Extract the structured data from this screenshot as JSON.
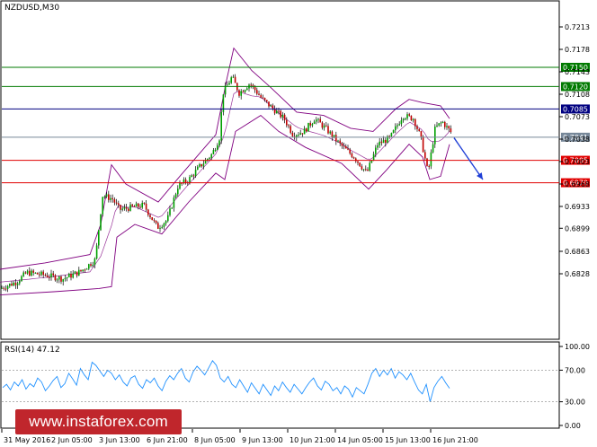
{
  "chart_data": [
    {
      "type": "candlestick",
      "title": "NZDUSD,M30",
      "ylim": [
        0.68,
        0.725
      ],
      "y_ticks": [
        "0.7213",
        "0.7178",
        "0.7143",
        "0.7108",
        "0.7073",
        "0.7038",
        "0.7003",
        "0.6968",
        "0.6933",
        "0.6899",
        "0.6863",
        "0.6828"
      ],
      "x_ticks": [
        "31 May 2016",
        "2 Jun 05:00",
        "3 Jun 13:00",
        "6 Jun 21:00",
        "8 Jun 05:00",
        "9 Jun 13:00",
        "10 Jun 21:00",
        "14 Jun 05:00",
        "15 Jun 13:00",
        "16 Jun 21:00"
      ],
      "levels": [
        {
          "label": "0.7150",
          "value": 0.715,
          "color": "#007a00"
        },
        {
          "label": "0.7120",
          "value": 0.712,
          "color": "#007a00"
        },
        {
          "label": "0.7085",
          "value": 0.7085,
          "color": "#000080"
        },
        {
          "label": "0.7041",
          "value": 0.7041,
          "color": "#778899"
        },
        {
          "label": "0.7005",
          "value": 0.7005,
          "color": "#e00000"
        },
        {
          "label": "0.6970",
          "value": 0.697,
          "color": "#e00000"
        }
      ],
      "close_path": [
        [
          0,
          0.6805
        ],
        [
          18,
          0.6815
        ],
        [
          30,
          0.683
        ],
        [
          50,
          0.6826
        ],
        [
          70,
          0.682
        ],
        [
          90,
          0.6832
        ],
        [
          106,
          0.685
        ],
        [
          114,
          0.695
        ],
        [
          125,
          0.6945
        ],
        [
          133,
          0.6928
        ],
        [
          148,
          0.6932
        ],
        [
          160,
          0.6935
        ],
        [
          175,
          0.69
        ],
        [
          186,
          0.6912
        ],
        [
          198,
          0.6965
        ],
        [
          210,
          0.6975
        ],
        [
          222,
          0.6995
        ],
        [
          236,
          0.7015
        ],
        [
          244,
          0.704
        ],
        [
          248,
          0.711
        ],
        [
          258,
          0.7135
        ],
        [
          266,
          0.711
        ],
        [
          278,
          0.7125
        ],
        [
          292,
          0.71
        ],
        [
          304,
          0.7085
        ],
        [
          316,
          0.707
        ],
        [
          326,
          0.7045
        ],
        [
          338,
          0.705
        ],
        [
          350,
          0.707
        ],
        [
          362,
          0.7055
        ],
        [
          378,
          0.703
        ],
        [
          394,
          0.701
        ],
        [
          408,
          0.6985
        ],
        [
          420,
          0.703
        ],
        [
          434,
          0.704
        ],
        [
          448,
          0.7075
        ],
        [
          460,
          0.707
        ],
        [
          468,
          0.704
        ],
        [
          476,
          0.6985
        ],
        [
          484,
          0.7055
        ],
        [
          492,
          0.7065
        ],
        [
          502,
          0.7048
        ]
      ],
      "bands_upper": [
        [
          0,
          0.6835
        ],
        [
          50,
          0.6845
        ],
        [
          100,
          0.6858
        ],
        [
          112,
          0.6905
        ],
        [
          124,
          0.6998
        ],
        [
          140,
          0.6968
        ],
        [
          176,
          0.694
        ],
        [
          200,
          0.698
        ],
        [
          240,
          0.7045
        ],
        [
          252,
          0.713
        ],
        [
          260,
          0.718
        ],
        [
          280,
          0.7145
        ],
        [
          300,
          0.712
        ],
        [
          330,
          0.708
        ],
        [
          360,
          0.7075
        ],
        [
          390,
          0.7055
        ],
        [
          415,
          0.705
        ],
        [
          440,
          0.7085
        ],
        [
          455,
          0.71
        ],
        [
          470,
          0.7095
        ],
        [
          490,
          0.709
        ],
        [
          500,
          0.707
        ]
      ],
      "bands_lower": [
        [
          0,
          0.6795
        ],
        [
          60,
          0.68
        ],
        [
          110,
          0.6805
        ],
        [
          124,
          0.6808
        ],
        [
          130,
          0.6885
        ],
        [
          150,
          0.6905
        ],
        [
          180,
          0.689
        ],
        [
          210,
          0.694
        ],
        [
          240,
          0.6985
        ],
        [
          250,
          0.6975
        ],
        [
          262,
          0.705
        ],
        [
          290,
          0.7075
        ],
        [
          310,
          0.705
        ],
        [
          340,
          0.7025
        ],
        [
          380,
          0.7
        ],
        [
          410,
          0.696
        ],
        [
          430,
          0.699
        ],
        [
          455,
          0.703
        ],
        [
          470,
          0.701
        ],
        [
          478,
          0.6975
        ],
        [
          490,
          0.698
        ],
        [
          500,
          0.703
        ]
      ],
      "forecast_arrow": {
        "from": [
          505,
          0.704
        ],
        "to": [
          537,
          0.6975
        ]
      }
    },
    {
      "type": "line",
      "title": "RSI(14) 47.12",
      "ylim": [
        0,
        100
      ],
      "y_ticks": [
        "100.00",
        "70.00",
        "30.00",
        "0.00"
      ],
      "levels": [
        70,
        30
      ],
      "values": [
        48,
        52,
        45,
        55,
        50,
        58,
        46,
        53,
        49,
        60,
        55,
        44,
        50,
        57,
        62,
        48,
        53,
        66,
        59,
        51,
        72,
        64,
        58,
        80,
        76,
        69,
        62,
        70,
        66,
        58,
        64,
        55,
        50,
        60,
        63,
        52,
        47,
        58,
        54,
        60,
        50,
        44,
        56,
        63,
        58,
        66,
        72,
        60,
        55,
        68,
        75,
        70,
        64,
        73,
        82,
        76,
        60,
        55,
        62,
        52,
        48,
        58,
        50,
        42,
        54,
        47,
        40,
        52,
        45,
        38,
        50,
        44,
        55,
        48,
        42,
        52,
        46,
        40,
        48,
        55,
        60,
        50,
        45,
        56,
        52,
        44,
        48,
        40,
        50,
        46,
        36,
        48,
        44,
        40,
        52,
        66,
        72,
        62,
        70,
        64,
        72,
        60,
        68,
        64,
        58,
        66,
        55,
        45,
        40,
        52,
        30,
        48,
        56,
        62,
        54,
        47
      ]
    }
  ],
  "watermark": "www.instaforex.com"
}
